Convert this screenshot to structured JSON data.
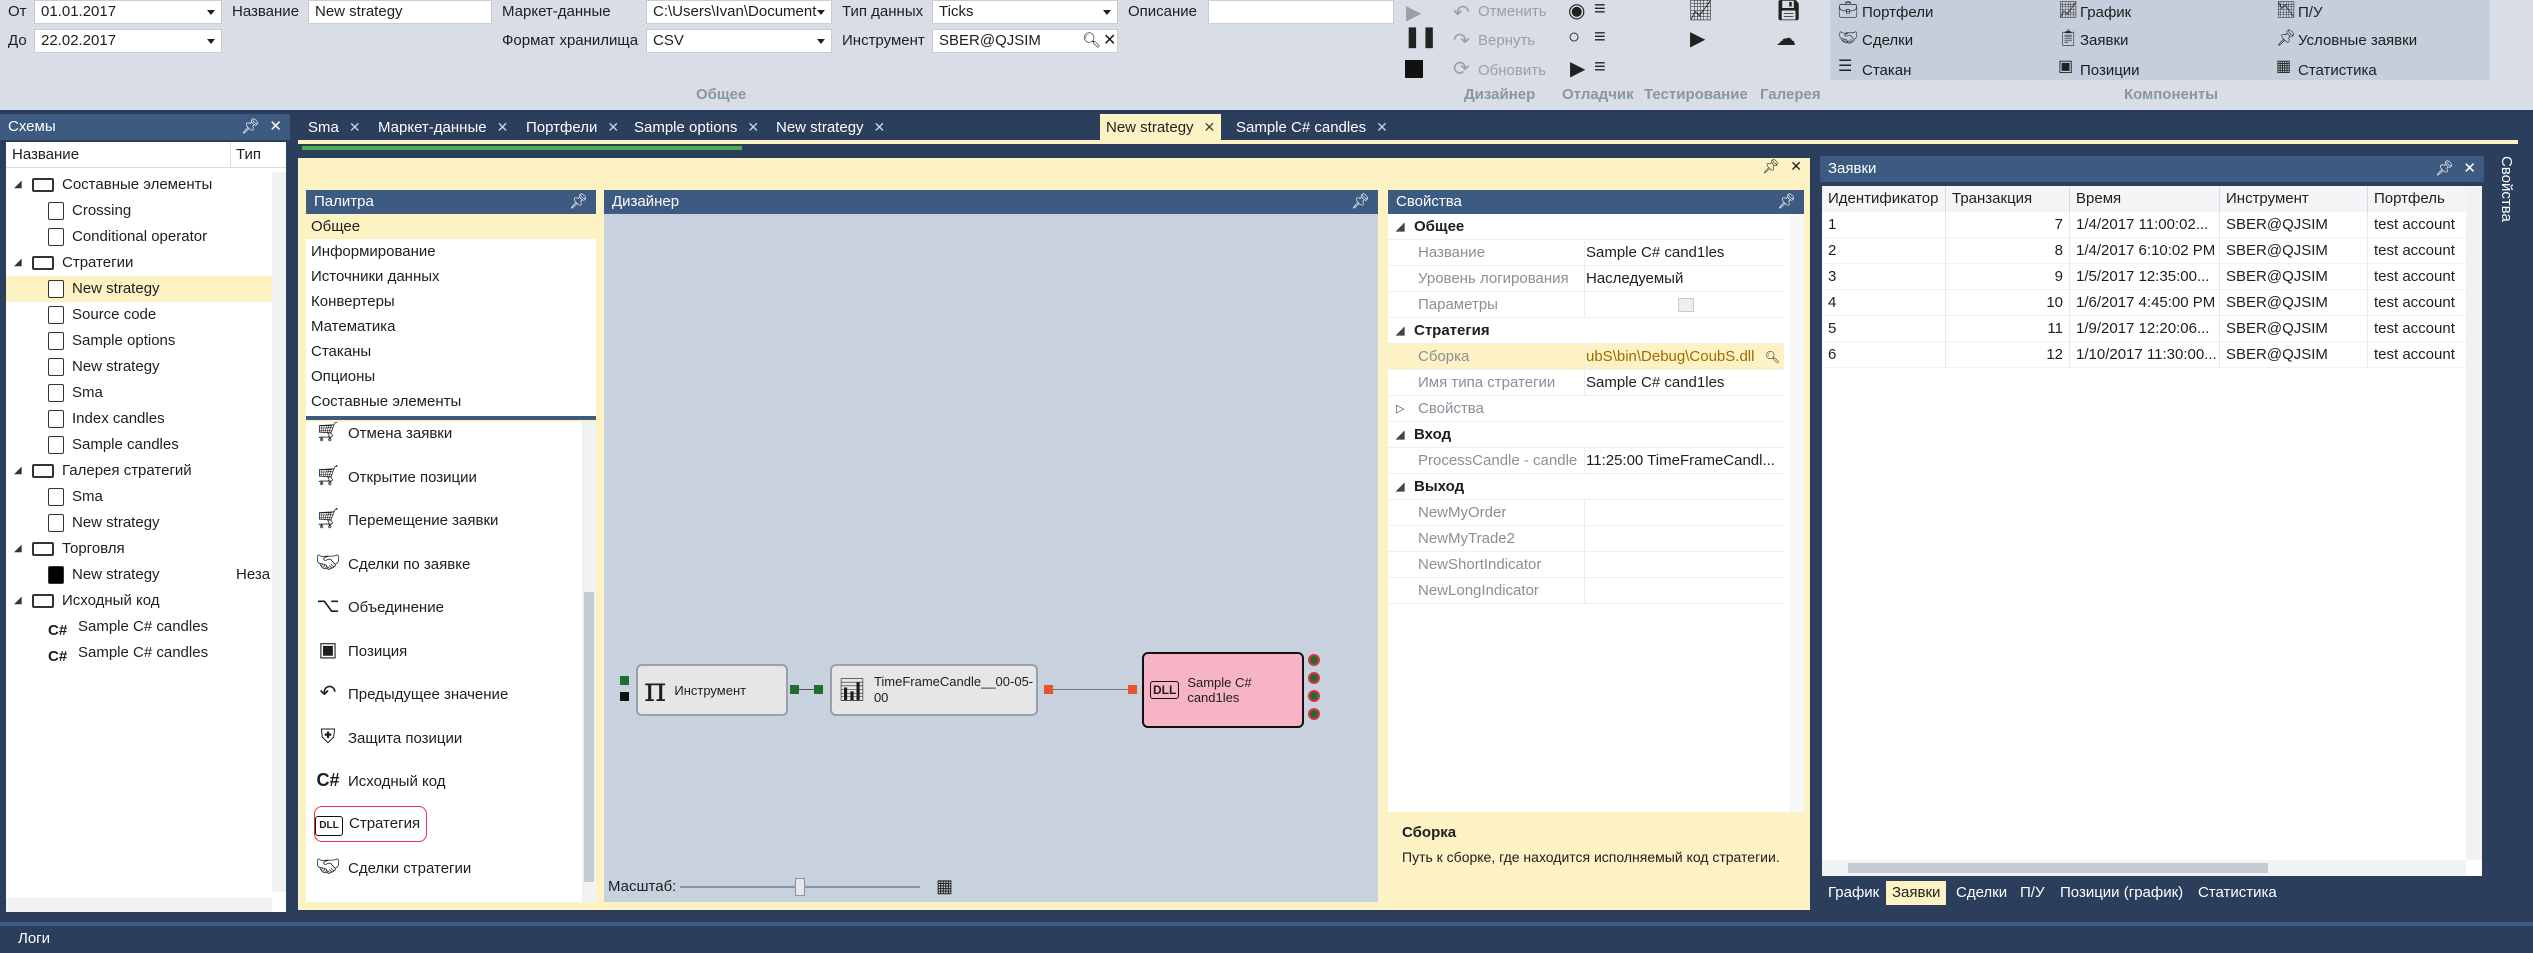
{
  "toolbar": {
    "from_label": "От",
    "from_value": "01.01.2017",
    "to_label": "До",
    "to_value": "22.02.2017",
    "name_label": "Название",
    "name_value": "New strategy",
    "market_data_label": "Маркет-данные",
    "market_data_value": "C:\\Users\\Ivan\\Document",
    "storage_format_label": "Формат хранилища",
    "storage_format_value": "CSV",
    "data_type_label": "Тип данных",
    "data_type_value": "Ticks",
    "instrument_label": "Инструмент",
    "instrument_value": "SBER@QJSIM",
    "description_label": "Описание",
    "description_value": "",
    "group_general": "Общее",
    "group_designer": "Дизайнер",
    "group_debugger": "Отладчик",
    "group_testing": "Тестирование",
    "group_gallery": "Галерея",
    "group_components": "Компоненты",
    "cancel_label": "Отменить",
    "revert_label": "Вернуть",
    "refresh_label": "Обновить",
    "components": [
      [
        "Портфели",
        "График",
        "П/У"
      ],
      [
        "Сделки",
        "Заявки",
        "Условные заявки"
      ],
      [
        "Стакан",
        "Позиции",
        "Статистика"
      ]
    ]
  },
  "schemes": {
    "title": "Схемы",
    "col_name": "Название",
    "col_type": "Тип",
    "rows": [
      {
        "label": "Составные элементы",
        "level": 0,
        "kind": "folder"
      },
      {
        "label": "Crossing",
        "level": 1,
        "kind": "composite"
      },
      {
        "label": "Conditional operator",
        "level": 1,
        "kind": "composite"
      },
      {
        "label": "Стратегии",
        "level": 0,
        "kind": "folder"
      },
      {
        "label": "New strategy",
        "level": 1,
        "kind": "doc",
        "selected": true
      },
      {
        "label": "Source code",
        "level": 1,
        "kind": "doc"
      },
      {
        "label": "Sample options",
        "level": 1,
        "kind": "doc"
      },
      {
        "label": "New strategy",
        "level": 1,
        "kind": "doc"
      },
      {
        "label": "Sma",
        "level": 1,
        "kind": "doc"
      },
      {
        "label": "Index candles",
        "level": 1,
        "kind": "doc"
      },
      {
        "label": "Sample candles",
        "level": 1,
        "kind": "doc"
      },
      {
        "label": "Галерея стратегий",
        "level": 0,
        "kind": "folder"
      },
      {
        "label": "Sma",
        "level": 1,
        "kind": "doc"
      },
      {
        "label": "New strategy",
        "level": 1,
        "kind": "doc"
      },
      {
        "label": "Торговля",
        "level": 0,
        "kind": "folder"
      },
      {
        "label": "New strategy",
        "level": 1,
        "kind": "black",
        "type": "Неза"
      },
      {
        "label": "Исходный код",
        "level": 0,
        "kind": "folder"
      },
      {
        "label": "Sample C# candles",
        "level": 1,
        "kind": "cs"
      },
      {
        "label": "Sample C# candles",
        "level": 1,
        "kind": "cs"
      }
    ]
  },
  "tabs": [
    {
      "label": "Sma"
    },
    {
      "label": "Маркет-данные"
    },
    {
      "label": "Портфели"
    },
    {
      "label": "Sample options"
    },
    {
      "label": "New strategy"
    },
    {
      "label": "New strategy",
      "active": true
    },
    {
      "label": "Sample C# candles"
    }
  ],
  "palette": {
    "title": "Палитра",
    "categories": [
      "Общее",
      "Информирование",
      "Источники данных",
      "Конвертеры",
      "Математика",
      "Стаканы",
      "Опционы",
      "Составные элементы"
    ],
    "items": [
      {
        "label": "Отмена заявки",
        "icon": "cart-cancel-icon"
      },
      {
        "label": "Открытие позиции",
        "icon": "cart-open-icon"
      },
      {
        "label": "Перемещение заявки",
        "icon": "cart-move-icon"
      },
      {
        "label": "Сделки по заявке",
        "icon": "handshake-icon"
      },
      {
        "label": "Объединение",
        "icon": "merge-icon"
      },
      {
        "label": "Позиция",
        "icon": "position-icon"
      },
      {
        "label": "Предыдущее значение",
        "icon": "back-arrow-icon"
      },
      {
        "label": "Защита позиции",
        "icon": "shield-icon"
      },
      {
        "label": "Исходный код",
        "icon": "csharp-icon"
      },
      {
        "label": "Стратегия",
        "icon": "dll-icon",
        "highlighted": true
      },
      {
        "label": "Сделки стратегии",
        "icon": "handshake-icon"
      }
    ]
  },
  "designer": {
    "title": "Дизайнер",
    "zoom_label": "Масштаб:",
    "zoom_level": 0.5,
    "nodes": {
      "instrument": "Инструмент",
      "timeframe": "TimeFrameCandle__00-05-00",
      "strategy": "Sample C# cand1les"
    }
  },
  "properties": {
    "title": "Свойства",
    "rows": [
      {
        "type": "cat",
        "key": "Общее"
      },
      {
        "key": "Название",
        "value": "Sample C# cand1les"
      },
      {
        "key": "Уровень логирования",
        "value": "Наследуемый"
      },
      {
        "key": "Параметры",
        "value": ""
      },
      {
        "type": "cat",
        "key": "Стратегия"
      },
      {
        "key": "Сборка",
        "value": "ubS\\bin\\Debug\\CoubS.dll",
        "selected": true
      },
      {
        "key": "Имя типа стратегии",
        "value": "Sample C# cand1les"
      },
      {
        "type": "subcat",
        "key": "Свойства"
      },
      {
        "type": "cat",
        "key": "Вход"
      },
      {
        "key": "ProcessCandle - candle",
        "value": "11:25:00  TimeFrameCandl..."
      },
      {
        "type": "cat",
        "key": "Выход"
      },
      {
        "key": "NewMyOrder",
        "value": ""
      },
      {
        "key": "NewMyTrade2",
        "value": ""
      },
      {
        "key": "NewShortIndicator",
        "value": ""
      },
      {
        "key": "NewLongIndicator",
        "value": ""
      }
    ],
    "help_title": "Сборка",
    "help_text": "Путь к сборке, где находится исполняемый код стратегии."
  },
  "orders": {
    "title": "Заявки",
    "columns": [
      "Идентификатор",
      "Транзакция",
      "Время",
      "Инструмент",
      "Портфель"
    ],
    "rows": [
      [
        "1",
        "7",
        "1/4/2017 11:00:02...",
        "SBER@QJSIM",
        "test account"
      ],
      [
        "2",
        "8",
        "1/4/2017 6:10:02 PM",
        "SBER@QJSIM",
        "test account"
      ],
      [
        "3",
        "9",
        "1/5/2017 12:35:00...",
        "SBER@QJSIM",
        "test account"
      ],
      [
        "4",
        "10",
        "1/6/2017 4:45:00 PM",
        "SBER@QJSIM",
        "test account"
      ],
      [
        "5",
        "11",
        "1/9/2017 12:20:06...",
        "SBER@QJSIM",
        "test account"
      ],
      [
        "6",
        "12",
        "1/10/2017 11:30:00...",
        "SBER@QJSIM",
        "test account"
      ]
    ],
    "bottom_tabs": [
      "График",
      "Заявки",
      "Сделки",
      "П/У",
      "Позиции (график)",
      "Статистика"
    ],
    "active_bottom_tab": 1
  },
  "side_label": "Свойства",
  "logs_label": "Логи",
  "colors": {
    "accent": "#fdf2c4",
    "panel_header": "#3d5a80",
    "background": "#2b3e5c",
    "node_highlight": "#f6b4c6"
  }
}
